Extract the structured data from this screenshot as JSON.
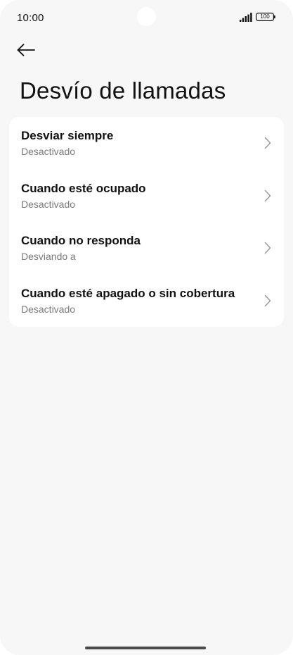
{
  "status_bar": {
    "time": "10:00",
    "battery_level": "100",
    "signal_icon": "signal-icon",
    "battery_icon": "battery-icon"
  },
  "header": {
    "back_icon": "arrow-left-icon",
    "title": "Desvío de llamadas"
  },
  "forwarding_options": [
    {
      "title": "Desviar siempre",
      "status": "Desactivado"
    },
    {
      "title": "Cuando esté ocupado",
      "status": "Desactivado"
    },
    {
      "title": "Cuando no responda",
      "status": "Desviando a"
    },
    {
      "title": "Cuando esté apagado o sin cobertura",
      "status": "Desactivado"
    }
  ],
  "colors": {
    "background": "#f7f7f7",
    "card": "#ffffff",
    "primary_text": "#111111",
    "secondary_text": "#7a7a7a",
    "chevron": "#9a9a9a"
  }
}
